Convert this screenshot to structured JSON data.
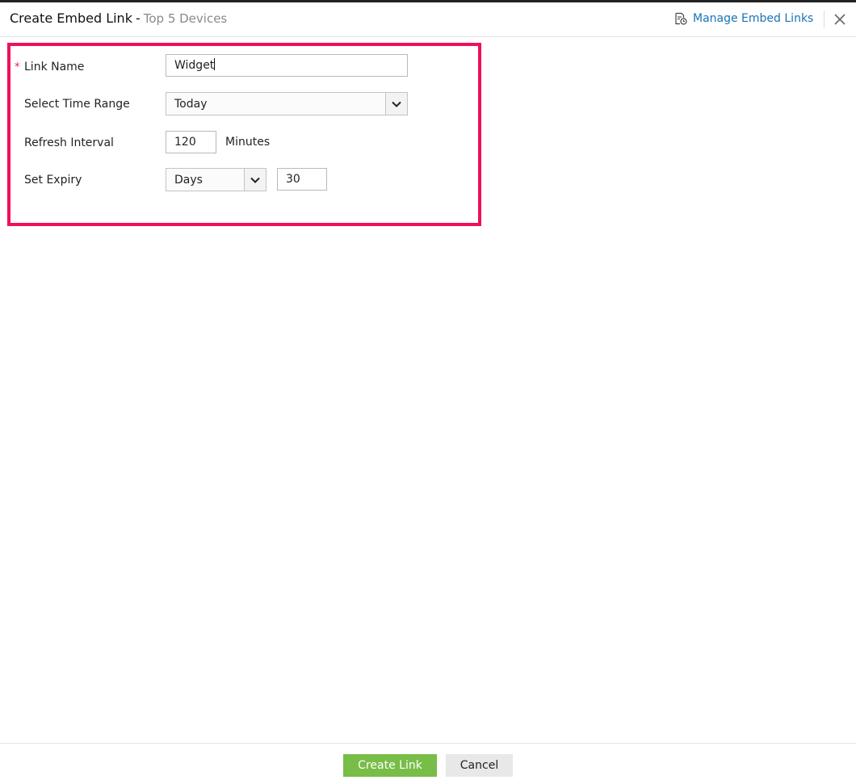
{
  "header": {
    "title": "Create Embed Link",
    "separator": "-",
    "subtitle": "Top 5 Devices",
    "manage_link": "Manage Embed Links",
    "manage_icon": "embed-links-history-icon",
    "close_icon": "close-icon"
  },
  "form": {
    "required_marker": "*",
    "link_name": {
      "label": "Link Name",
      "value": "Widget"
    },
    "time_range": {
      "label": "Select Time Range",
      "value": "Today"
    },
    "refresh_interval": {
      "label": "Refresh Interval",
      "value": "120",
      "unit": "Minutes"
    },
    "expiry": {
      "label": "Set Expiry",
      "unit_value": "Days",
      "value": "30"
    }
  },
  "footer": {
    "create_label": "Create Link",
    "cancel_label": "Cancel"
  },
  "colors": {
    "link": "#1a73b5",
    "highlight": "#f0105a",
    "primary_button": "#78bd47",
    "required": "#e0204a"
  }
}
